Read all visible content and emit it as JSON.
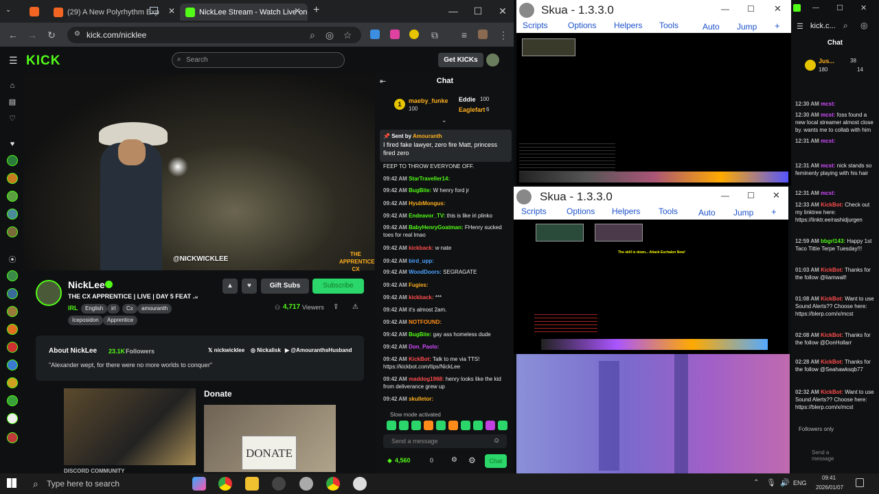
{
  "browser": {
    "tabs": [
      {
        "label": "(29) A New Polyrhythm Exp"
      },
      {
        "label": "NickLee Stream - Watch Live on"
      }
    ],
    "url": "kick.com/nicklee",
    "new_tab_glyph": "+"
  },
  "kick": {
    "logo": "KICK",
    "search_placeholder": "Search",
    "get_kicks": "Get KICKs",
    "watermark": "@NICKWICKLEE",
    "brand_overlay": "THE APPRENTICE CX",
    "channel": {
      "name": "NickLee",
      "title": "THE CX APPRENTICE | LIVE | DAY 5 FEAT ...",
      "category": "IRL",
      "tags": [
        "English",
        "irl",
        "Cx",
        "amouranth",
        "Iceposidon",
        "Apprentice"
      ],
      "viewers": "4,717",
      "viewers_label": "Viewers",
      "gift_subs": "Gift Subs",
      "subscribe": "Subscribe"
    },
    "about": {
      "title": "About NickLee",
      "followers": "23.1K",
      "followers_label": "Followers",
      "quote": "\"Alexander wept, for there were no more worlds to conquer\"",
      "socials": [
        "nickwicklee",
        "Nickalisk",
        "@AmouranthsHusband"
      ]
    },
    "panels": {
      "discord_caption": "DISCORD COMMUNITY",
      "donate_heading": "Donate",
      "donate_sign": "DONATE"
    }
  },
  "chat": {
    "header": "Chat",
    "leaderboard": [
      {
        "rank": "1",
        "name": "maeby_funke",
        "value": "100"
      },
      {
        "name": "Eddie",
        "value": "100"
      },
      {
        "name": "Eaglefart",
        "value": "6"
      }
    ],
    "pinned": {
      "sent_by": "Sent by",
      "user": "Amouranth",
      "text": "I fired fake lawyer, zero fire Matt, princess fired zero"
    },
    "messages": [
      {
        "ts": "",
        "user": "",
        "text": "FEEP TO THROW EVERYONE OFF.",
        "color": "#eeeeee"
      },
      {
        "ts": "09:42 AM",
        "user": "StarTraveller14:",
        "text": "",
        "color": "#53fc18"
      },
      {
        "ts": "09:42 AM",
        "user": "BugBite:",
        "text": "W henry ford jr",
        "color": "#53fc18"
      },
      {
        "ts": "09:42 AM",
        "user": "HyubMongus:",
        "text": "",
        "color": "#ffb020"
      },
      {
        "ts": "09:42 AM",
        "user": "Endeavor_TV:",
        "text": "this is like iri plinko",
        "color": "#53fc18"
      },
      {
        "ts": "09:42 AM",
        "user": "BabyHenryGoatman:",
        "text": "FHenry sucked toes for real lmao",
        "color": "#53fc18"
      },
      {
        "ts": "09:42 AM",
        "user": "kickback:",
        "text": "w nate",
        "color": "#ff4d4d"
      },
      {
        "ts": "09:42 AM",
        "user": "bird_upp:",
        "text": "",
        "color": "#4da3ff"
      },
      {
        "ts": "09:42 AM",
        "user": "WoodDoors:",
        "text": "SEGRAGATE",
        "color": "#4da3ff"
      },
      {
        "ts": "09:42 AM",
        "user": "Fugies:",
        "text": "",
        "color": "#ffb020"
      },
      {
        "ts": "09:42 AM",
        "user": "kickback:",
        "text": "***",
        "color": "#ff4d4d"
      },
      {
        "ts": "09:42 AM",
        "user": "",
        "text": "it's almost 2am.",
        "color": "#d24dff"
      },
      {
        "ts": "09:42 AM",
        "user": "NOTFOUND:",
        "text": "",
        "color": "#ff8c1a"
      },
      {
        "ts": "09:42 AM",
        "user": "BugBite:",
        "text": "gay ass homeless dude",
        "color": "#53fc18"
      },
      {
        "ts": "09:42 AM",
        "user": "Don_Paolo:",
        "text": "",
        "color": "#d24dff"
      },
      {
        "ts": "09:42 AM",
        "user": "KickBot:",
        "text": "Talk to me via TTS! https://kickbot.com/tips/NickLee",
        "color": "#ff4d4d"
      },
      {
        "ts": "09:42 AM",
        "user": "maddog1968:",
        "text": "henry looks like the kid from deliverance grew up",
        "color": "#ff4d4d"
      },
      {
        "ts": "09:42 AM",
        "user": "skulletor:",
        "text": "",
        "color": "#ffb020"
      }
    ],
    "slow_mode": "Slow mode activated",
    "input_placeholder": "Send a message",
    "points": "4,560",
    "zero": "0",
    "chat_button": "Chat"
  },
  "skua1": {
    "title": "Skua - 1.3.3.0",
    "menu": [
      "Scripts",
      "Options",
      "Helpers",
      "Tools",
      "Auto",
      "Jump"
    ]
  },
  "skua2": {
    "title": "Skua - 1.3.3.0",
    "menu": [
      "Scripts",
      "Options",
      "Helpers",
      "Tools",
      "Auto",
      "Jump"
    ],
    "banner": "The skill is down... Attack Eschalon Now!"
  },
  "rchat": {
    "url": "kick.c...",
    "header": "Chat",
    "leader": {
      "name": "Jus...",
      "a": "38",
      "b": "180",
      "c": "14"
    },
    "messages": [
      {
        "ts": "12:30 AM",
        "user": "mcst:",
        "text": "",
        "color": "#d24dff"
      },
      {
        "ts": "12:30 AM",
        "user": "mcst:",
        "text": "foss found a new local streamer almost close by. wants me to collab with him",
        "color": "#d24dff"
      },
      {
        "ts": "12:31 AM",
        "user": "mcst:",
        "text": "",
        "color": "#d24dff"
      },
      {
        "ts": "12:31 AM",
        "user": "mcst:",
        "text": "nick stands so feminenly playing with his hair",
        "color": "#d24dff"
      },
      {
        "ts": "12:31 AM",
        "user": "mcst:",
        "text": "",
        "color": "#d24dff"
      },
      {
        "ts": "12:33 AM",
        "user": "KickBot:",
        "text": "Check out my linktree here: https://linktr.ee/rashidjurgen",
        "color": "#ff4d4d"
      },
      {
        "ts": "12:59 AM",
        "user": "bbgrl143:",
        "text": "Happy 1st Taco Tittie Terpe Tuesday!!!",
        "color": "#53fc18"
      },
      {
        "ts": "01:03 AM",
        "user": "KickBot:",
        "text": "Thanks for the follow @liamwall!",
        "color": "#ff4d4d"
      },
      {
        "ts": "01:08 AM",
        "user": "KickBot:",
        "text": "Want to use Sound Alerts?? Choose here: https://blerp.com/x/mcst",
        "color": "#ff4d4d"
      },
      {
        "ts": "02:08 AM",
        "user": "KickBot:",
        "text": "Thanks for the follow @DonHollarr",
        "color": "#ff4d4d"
      },
      {
        "ts": "02:28 AM",
        "user": "KickBot:",
        "text": "Thanks for the follow @Seahawksqb77",
        "color": "#ff4d4d"
      },
      {
        "ts": "02:32 AM",
        "user": "KickBot:",
        "text": "Want to use Sound Alerts?? Choose here: https://blerp.com/x/mcst",
        "color": "#ff4d4d"
      }
    ],
    "followers_only": "Followers only",
    "input_placeholder": "Send a message"
  },
  "taskbar": {
    "search_placeholder": "Type here to search",
    "lang": "ENG",
    "time": "09:41",
    "date": "2026/01/07"
  }
}
